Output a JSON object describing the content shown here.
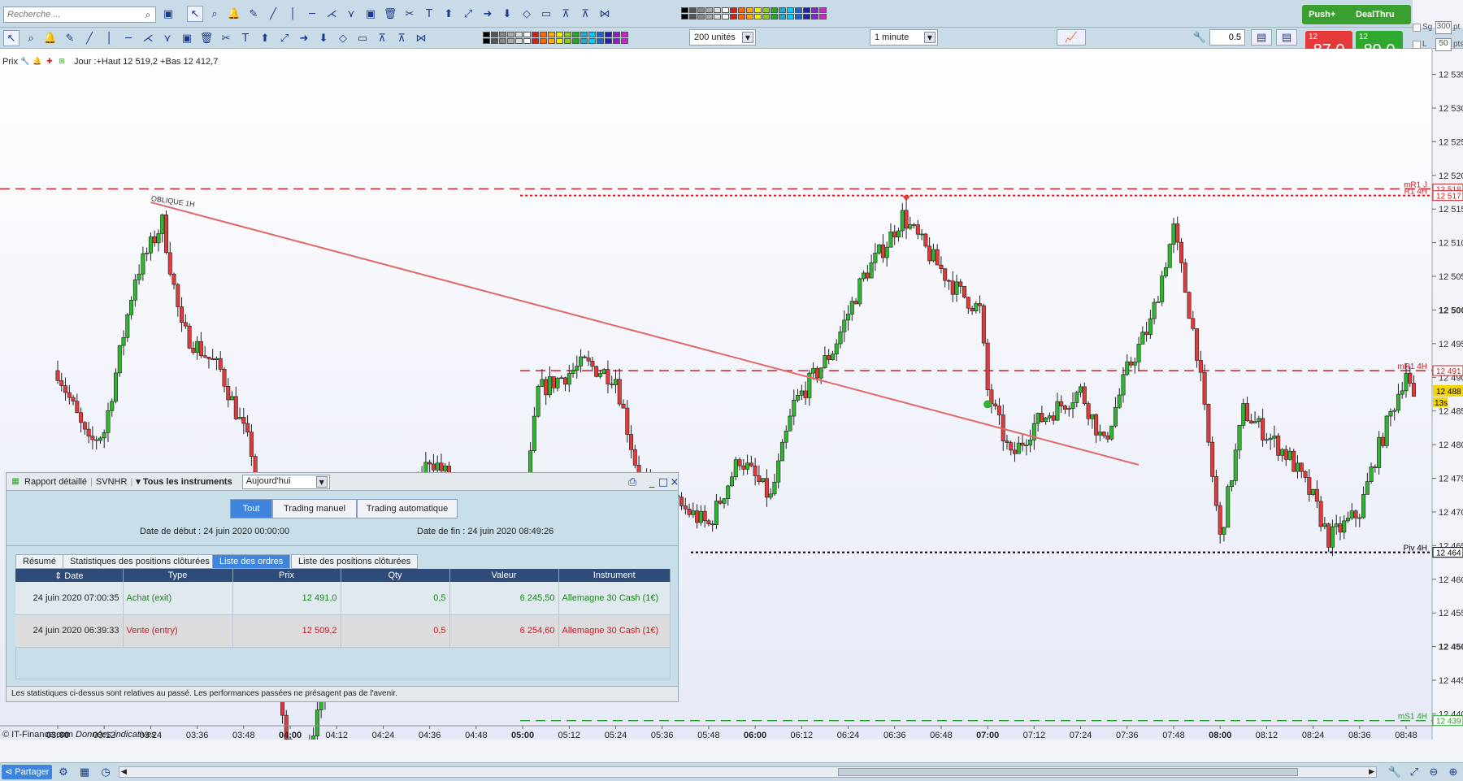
{
  "toolbar": {
    "search_placeholder": "Recherche ...",
    "units": "200 unités",
    "interval": "1 minute",
    "qty": "0.5",
    "push_label": "Push+",
    "dealthru_label": "DealThru",
    "sell_prefix": "12 4",
    "sell_price": "87,0",
    "buy_prefix": "12 4",
    "buy_price": "89,0",
    "pts_300": "300",
    "pts_50": "50",
    "pts_unit1": "pt",
    "pts_unit2": "pts",
    "sg_label": "Sg",
    "l_label": "L"
  },
  "chart_header": {
    "prix": "Prix",
    "info": "Jour :+Haut 12 519,2 +Bas 12 412,7"
  },
  "chart_data": {
    "type": "candlestick",
    "x_ticks": [
      "03:00",
      "03:12",
      "03:24",
      "03:36",
      "03:48",
      "04:00",
      "04:12",
      "04:24",
      "04:36",
      "04:48",
      "05:00",
      "05:12",
      "05:24",
      "05:36",
      "05:48",
      "06:00",
      "06:12",
      "06:24",
      "06:36",
      "06:48",
      "07:00",
      "07:12",
      "07:24",
      "07:36",
      "07:48",
      "08:00",
      "08:12",
      "08:24",
      "08:36",
      "08:48"
    ],
    "bold_ticks": [
      "03:00",
      "04:00",
      "05:00",
      "06:00",
      "07:00",
      "08:00"
    ],
    "y_ticks": [
      "12 535",
      "12 530",
      "12 525",
      "12 520",
      "12 515",
      "12 510",
      "12 505",
      "12 500",
      "12 495",
      "12 490",
      "12 485",
      "12 480",
      "12 475",
      "12 470",
      "12 465",
      "12 460",
      "12 455",
      "12 450",
      "12 445",
      "12 440"
    ],
    "ylim": [
      12438,
      12537
    ],
    "levels": [
      {
        "name": "mR1 J",
        "value": 12518,
        "label": "12 518",
        "color": "#d4202a",
        "style": "dash"
      },
      {
        "name": "R1 4H",
        "value": 12517,
        "label": "12 517",
        "color": "#d4202a",
        "style": "dot"
      },
      {
        "name": "mR1 4H",
        "value": 12491,
        "label": "12 491",
        "color": "#d4202a",
        "style": "dash"
      },
      {
        "name": "Piv 4H",
        "value": 12464,
        "label": "12 464",
        "color": "#000000",
        "style": "dot"
      },
      {
        "name": "mS1 4H",
        "value": 12439,
        "label": "12 439",
        "color": "#2a9a2a",
        "style": "dash"
      }
    ],
    "current_price": "12 488",
    "countdown": "13s",
    "trendline_label": "OBLIQUE 1H",
    "series": [
      {
        "name": "close",
        "anchors": [
          [
            "03:00",
            12491
          ],
          [
            "03:08",
            12480
          ],
          [
            "03:12",
            12482
          ],
          [
            "03:20",
            12505
          ],
          [
            "03:27",
            12513
          ],
          [
            "03:32",
            12497
          ],
          [
            "03:42",
            12491
          ],
          [
            "03:50",
            12479
          ],
          [
            "04:00",
            12430
          ],
          [
            "04:36",
            12478
          ],
          [
            "04:50",
            12470
          ],
          [
            "05:00",
            12468
          ],
          [
            "05:04",
            12488
          ],
          [
            "05:16",
            12492
          ],
          [
            "05:24",
            12490
          ],
          [
            "05:30",
            12475
          ],
          [
            "05:48",
            12468
          ],
          [
            "05:56",
            12478
          ],
          [
            "06:04",
            12472
          ],
          [
            "06:10",
            12486
          ],
          [
            "06:20",
            12494
          ],
          [
            "06:28",
            12505
          ],
          [
            "06:34",
            12510
          ],
          [
            "06:38",
            12514
          ],
          [
            "06:44",
            12509
          ],
          [
            "06:52",
            12503
          ],
          [
            "06:58",
            12500
          ],
          [
            "07:00",
            12488
          ],
          [
            "07:06",
            12478
          ],
          [
            "07:12",
            12483
          ],
          [
            "07:24",
            12488
          ],
          [
            "07:30",
            12480
          ],
          [
            "07:36",
            12491
          ],
          [
            "07:42",
            12498
          ],
          [
            "07:48",
            12512
          ],
          [
            "07:54",
            12494
          ],
          [
            "08:00",
            12466
          ],
          [
            "08:06",
            12485
          ],
          [
            "08:18",
            12478
          ],
          [
            "08:24",
            12472
          ],
          [
            "08:28",
            12466
          ],
          [
            "08:36",
            12470
          ],
          [
            "08:40",
            12478
          ],
          [
            "08:48",
            12491
          ],
          [
            "08:50",
            12486
          ]
        ]
      }
    ]
  },
  "panel": {
    "title": "Rapport détaillé",
    "account": "SVNHR",
    "filter": "Tous les instruments",
    "period": "Aujourd'hui",
    "seg": [
      "Tout",
      "Trading manuel",
      "Trading automatique"
    ],
    "start_label": "Date de début :",
    "start_value": "24 juin 2020 00:00:00",
    "end_label": "Date de fin :",
    "end_value": "24 juin 2020 08:49:26",
    "tabs": [
      "Résumé",
      "Statistiques des positions clôturées",
      "Liste des ordres",
      "Liste des positions clôturées"
    ],
    "columns": [
      "Date",
      "Type",
      "Prix",
      "Qty",
      "Valeur",
      "Instrument"
    ],
    "rows": [
      {
        "date": "24 juin 2020 07:00:35",
        "type": "Achat (exit)",
        "prix": "12 491,0",
        "qty": "0,5",
        "valeur": "6 245,50",
        "instrument": "Allemagne 30 Cash (1€)"
      },
      {
        "date": "24 juin 2020 06:39:33",
        "type": "Vente (entry)",
        "prix": "12 509,2",
        "qty": "0,5",
        "valeur": "6 254,60",
        "instrument": "Allemagne 30 Cash (1€)"
      }
    ],
    "footer": "Les statistiques ci-dessus sont relatives au passé. Les performances passées ne présagent pas de l'avenir."
  },
  "copyright": "© IT-Finance.com",
  "copyright_note": "Données indicatives",
  "status": {
    "share": "Partager"
  }
}
